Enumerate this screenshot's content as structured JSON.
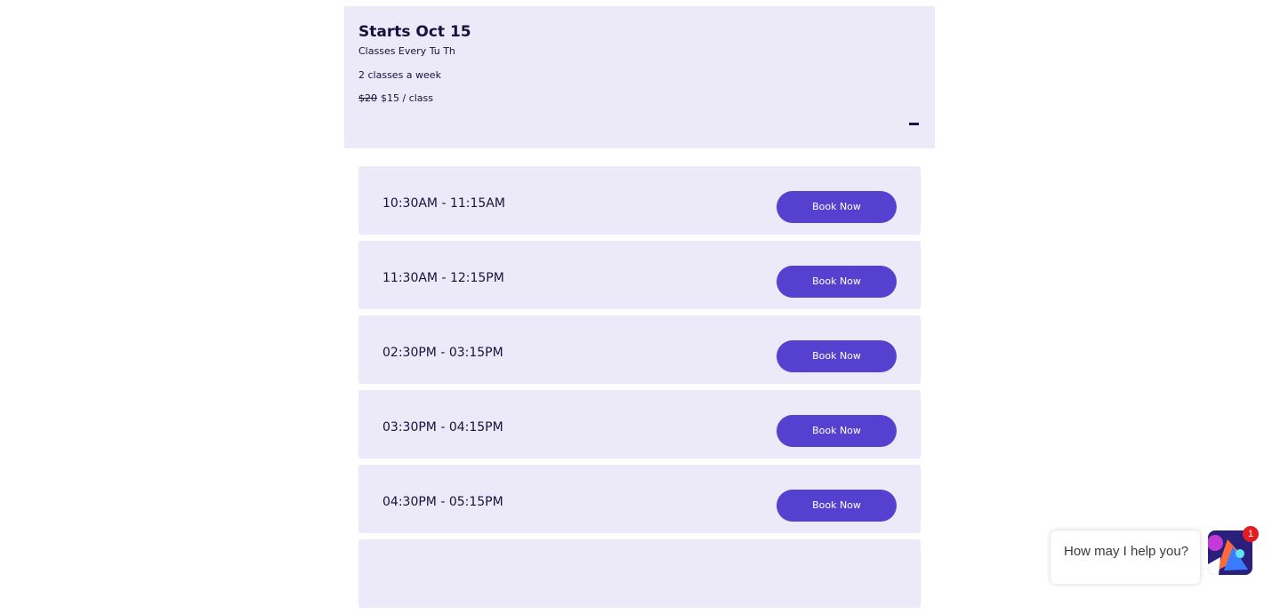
{
  "course": {
    "title": "Starts Oct 15",
    "schedule": "Classes Every Tu Th",
    "frequency": "2 classes a week",
    "price_old": "$20",
    "price_new": "$15 / class",
    "collapse_icon": "minus-icon"
  },
  "slots": [
    {
      "time": "10:30AM - 11:15AM",
      "button": "Book Now"
    },
    {
      "time": "11:30AM - 12:15PM",
      "button": "Book Now"
    },
    {
      "time": "02:30PM - 03:15PM",
      "button": "Book Now"
    },
    {
      "time": "03:30PM - 04:15PM",
      "button": "Book Now"
    },
    {
      "time": "04:30PM - 05:15PM",
      "button": "Book Now"
    }
  ],
  "chat": {
    "prompt": "How may I help you?",
    "badge_count": "1",
    "launcher_icon": "chat-assistant-icon"
  },
  "colors": {
    "card_background": "#ece9f8",
    "button_primary": "#5540cf",
    "text_dark": "#16123d",
    "badge": "#e31b23"
  }
}
